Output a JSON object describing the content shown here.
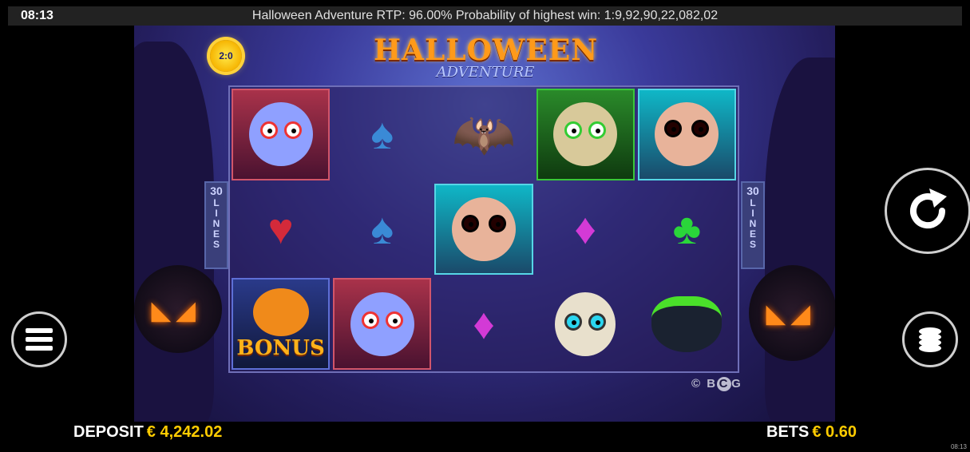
{
  "status_bar": {
    "time": "08:13",
    "info": "Halloween Adventure RTP: 96.00%   Probability of highest win: 1:9,92,90,22,082,02"
  },
  "game": {
    "logo_title": "HALLOWEEN",
    "logo_subtitle": "ADVENTURE",
    "badge_text": "2:0",
    "lines_left": {
      "number": "30",
      "word": "LINES"
    },
    "lines_right": {
      "number": "30",
      "word": "LINES"
    },
    "provider": "B G",
    "provider_mark": "C",
    "copyright": "©",
    "bonus_label": "BONUS"
  },
  "reels": [
    [
      "vampire",
      "spade",
      "bat",
      "mummy",
      "spider"
    ],
    [
      "heart",
      "spade",
      "spider",
      "diamond",
      "club"
    ],
    [
      "bonus-pumpkin",
      "vampire",
      "diamond",
      "skull",
      "cauldron"
    ]
  ],
  "footer": {
    "deposit_label": "DEPOSIT",
    "deposit_value": "€ 4,242.02",
    "bets_label": "BETS",
    "bets_value": "€ 0.60",
    "tiny_time": "08:13"
  },
  "icons": {
    "spin": "refresh-icon",
    "menu": "menu-icon",
    "coins": "coin-stack-icon"
  },
  "colors": {
    "gold": "#ffcc00",
    "accent_orange": "#ff9a1a"
  }
}
